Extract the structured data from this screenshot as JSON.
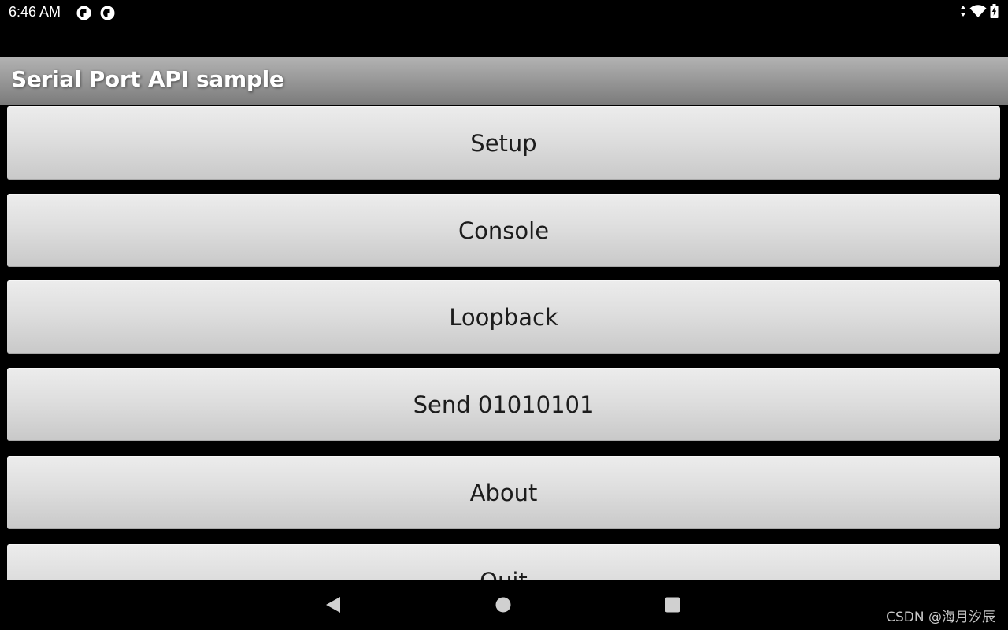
{
  "status_bar": {
    "time": "6:46 AM",
    "notification_icons": [
      "app-notification-icon",
      "app-notification-icon"
    ],
    "indicators": [
      "data-arrows-icon",
      "wifi-icon",
      "battery-charging-icon"
    ]
  },
  "app": {
    "title": "Serial Port API sample"
  },
  "menu": {
    "buttons": [
      {
        "label": "Setup"
      },
      {
        "label": "Console"
      },
      {
        "label": "Loopback"
      },
      {
        "label": "Send 01010101"
      },
      {
        "label": "About"
      },
      {
        "label": "Quit"
      }
    ]
  },
  "nav_bar": {
    "icons": [
      "back-icon",
      "home-icon",
      "recents-icon"
    ]
  },
  "watermark": "CSDN @海月汐辰",
  "colors": {
    "background": "#000000",
    "button_top": "#ececec",
    "button_bottom": "#c9c9c9",
    "title_bar_top": "#b3b3b3",
    "title_bar_bottom": "#7b7b7b",
    "nav_icon": "#d0d0d0"
  }
}
